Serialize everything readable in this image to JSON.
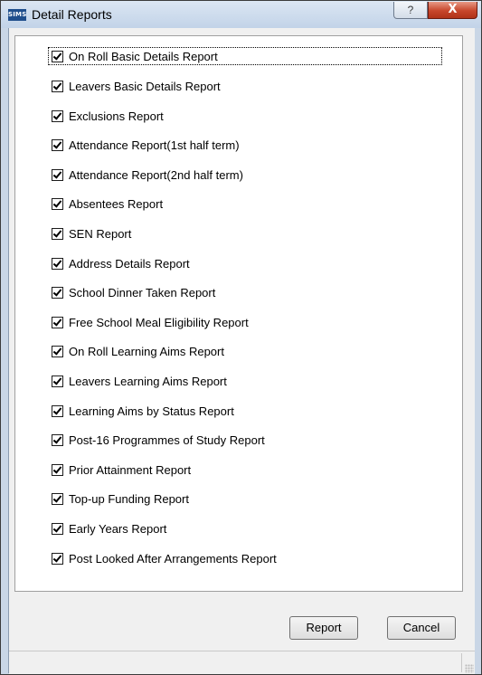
{
  "window": {
    "title": "Detail Reports",
    "app_icon_text": "SIMS",
    "help_label": "?",
    "close_label": "X"
  },
  "reports": [
    {
      "label": "On Roll Basic Details Report",
      "checked": true
    },
    {
      "label": "Leavers Basic Details Report",
      "checked": true
    },
    {
      "label": "Exclusions Report",
      "checked": true
    },
    {
      "label": "Attendance Report(1st half term)",
      "checked": true
    },
    {
      "label": "Attendance Report(2nd half term)",
      "checked": true
    },
    {
      "label": "Absentees Report",
      "checked": true
    },
    {
      "label": "SEN Report",
      "checked": true
    },
    {
      "label": "Address Details Report",
      "checked": true
    },
    {
      "label": "School Dinner Taken Report",
      "checked": true
    },
    {
      "label": "Free School Meal Eligibility Report",
      "checked": true
    },
    {
      "label": "On Roll Learning Aims Report",
      "checked": true
    },
    {
      "label": "Leavers Learning Aims Report",
      "checked": true
    },
    {
      "label": "Learning Aims by Status Report",
      "checked": true
    },
    {
      "label": "Post-16 Programmes of Study Report",
      "checked": true
    },
    {
      "label": "Prior Attainment Report",
      "checked": true
    },
    {
      "label": "Top-up Funding Report",
      "checked": true
    },
    {
      "label": "Early Years Report",
      "checked": true
    },
    {
      "label": "Post Looked After Arrangements Report",
      "checked": true
    }
  ],
  "buttons": {
    "report_label": "Report",
    "cancel_label": "Cancel"
  },
  "icons": {
    "app": "sims-app-icon",
    "help": "help-icon",
    "close": "close-icon",
    "grip": "resize-grip-icon"
  },
  "colors": {
    "close_button": "#c7462b",
    "title_bar": "#c2d3e8"
  }
}
